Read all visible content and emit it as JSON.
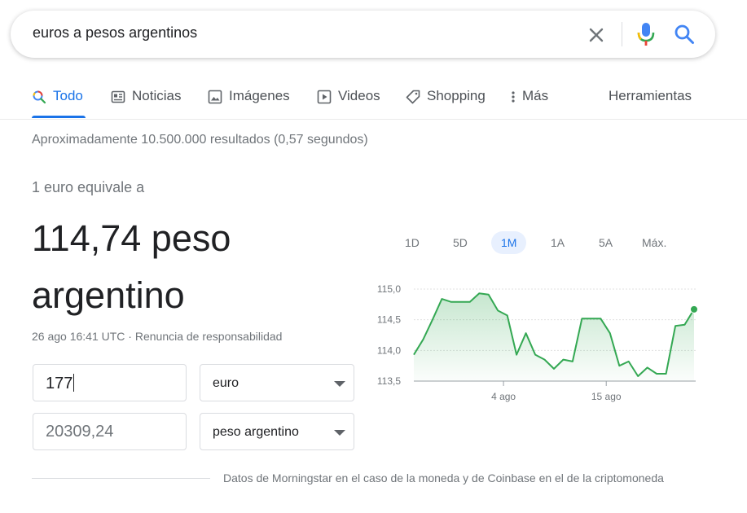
{
  "search": {
    "query": "euros a pesos argentinos"
  },
  "tabs": [
    {
      "label": "Todo",
      "icon": "search-icon",
      "active": true
    },
    {
      "label": "Noticias",
      "icon": "news-icon"
    },
    {
      "label": "Imágenes",
      "icon": "image-icon"
    },
    {
      "label": "Videos",
      "icon": "video-icon"
    },
    {
      "label": "Shopping",
      "icon": "tag-icon"
    },
    {
      "label": "Más",
      "icon": "more-vert-icon"
    }
  ],
  "tools_label": "Herramientas",
  "results_count": "Aproximadamente 10.500.000 resultados (0,57 segundos)",
  "converter": {
    "equiv_label": "1 euro equivale a",
    "rate_text": "114,74 peso argentino",
    "date": "26 ago 16:41 UTC",
    "separator": " · ",
    "disclaimer": "Renuncia de responsabilidad",
    "from_amount": "177",
    "from_currency": "euro",
    "to_amount": "20309,24",
    "to_currency": "peso argentino"
  },
  "ranges": [
    {
      "label": "1D"
    },
    {
      "label": "5D"
    },
    {
      "label": "1M",
      "active": true
    },
    {
      "label": "1A"
    },
    {
      "label": "5A"
    },
    {
      "label": "Máx."
    }
  ],
  "chart_data": {
    "type": "area",
    "ylim": [
      113.5,
      115.0
    ],
    "y_ticks": [
      "115,0",
      "114,5",
      "114,0",
      "113,5"
    ],
    "x_ticks": [
      {
        "label": "4 ago",
        "day": 9.6
      },
      {
        "label": "15 ago",
        "day": 20.6
      }
    ],
    "x_days": [
      0,
      1,
      2,
      3,
      4,
      5,
      6,
      7,
      8,
      9,
      10,
      11,
      12,
      13,
      14,
      15,
      16,
      17,
      18,
      19,
      20,
      21,
      22,
      23,
      24,
      25,
      26,
      27,
      28,
      29,
      30
    ],
    "values": [
      113.93,
      114.18,
      114.5,
      114.84,
      114.79,
      114.79,
      114.79,
      114.93,
      114.91,
      114.65,
      114.57,
      113.93,
      114.28,
      113.93,
      113.85,
      113.7,
      113.85,
      113.82,
      114.52,
      114.52,
      114.52,
      114.28,
      113.75,
      113.82,
      113.58,
      113.72,
      113.62,
      113.62,
      114.4,
      114.42,
      114.67
    ],
    "color": "#34a853"
  },
  "footer": {
    "source": "Datos de Morningstar en el caso de la moneda y de Coinbase en el de la criptomoneda"
  }
}
